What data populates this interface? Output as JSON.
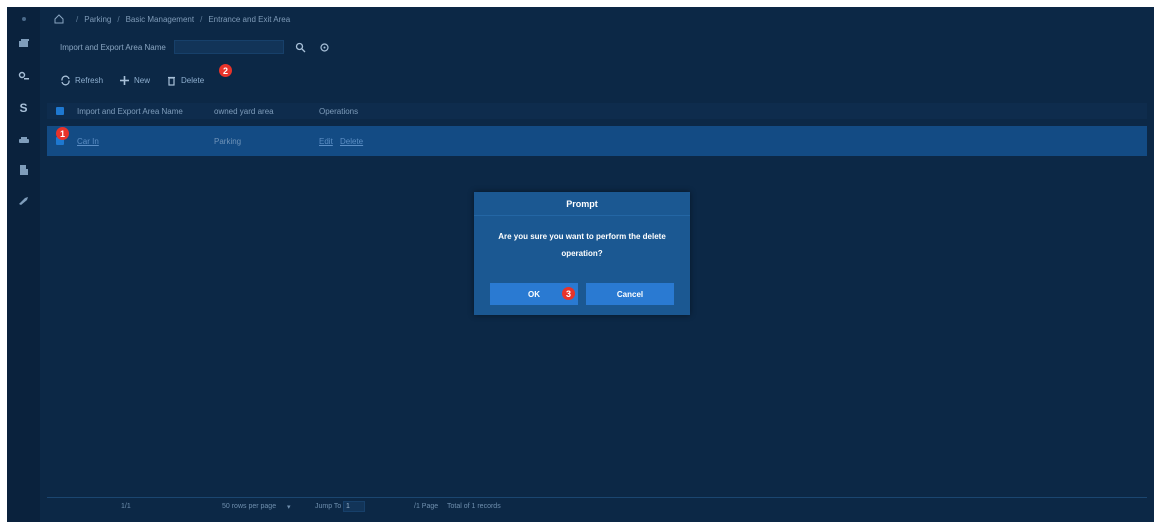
{
  "colors": {
    "background": "#0c2846",
    "selected_row": "#134b84",
    "dialog": "#1b5892",
    "button": "#2a7ad2",
    "badge": "#e8332a",
    "link": "#5d8fc5"
  },
  "sidebar": {
    "icons": [
      "home-icon",
      "card-icon",
      "key-icon",
      "dollar-icon",
      "car-icon",
      "building-icon",
      "tools-icon"
    ],
    "dollar_glyph": "S"
  },
  "breadcrumb": {
    "items": [
      "Parking",
      "Basic Management",
      "Entrance and Exit Area"
    ],
    "separator": "/"
  },
  "search": {
    "label": "Import and Export Area Name",
    "value": "",
    "placeholder": ""
  },
  "toolbar": {
    "refresh_label": "Refresh",
    "new_label": "New",
    "delete_label": "Delete"
  },
  "table": {
    "columns": [
      "Import and Export Area Name",
      "owned yard area",
      "Operations"
    ],
    "rows": [
      {
        "name": "Car In",
        "yard": "Parking",
        "edit": "Edit",
        "delete": "Delete"
      }
    ]
  },
  "pagination": {
    "page_display": "1/1",
    "rows_per_page": "50 rows per page",
    "jump_label": "Jump To",
    "jump_value": "1",
    "page_suffix": "/1 Page",
    "total": "Total of 1 records"
  },
  "dialog": {
    "title": "Prompt",
    "message": "Are you sure you want to perform the delete operation?",
    "ok_label": "OK",
    "cancel_label": "Cancel"
  },
  "badges": [
    "1",
    "2",
    "3"
  ]
}
